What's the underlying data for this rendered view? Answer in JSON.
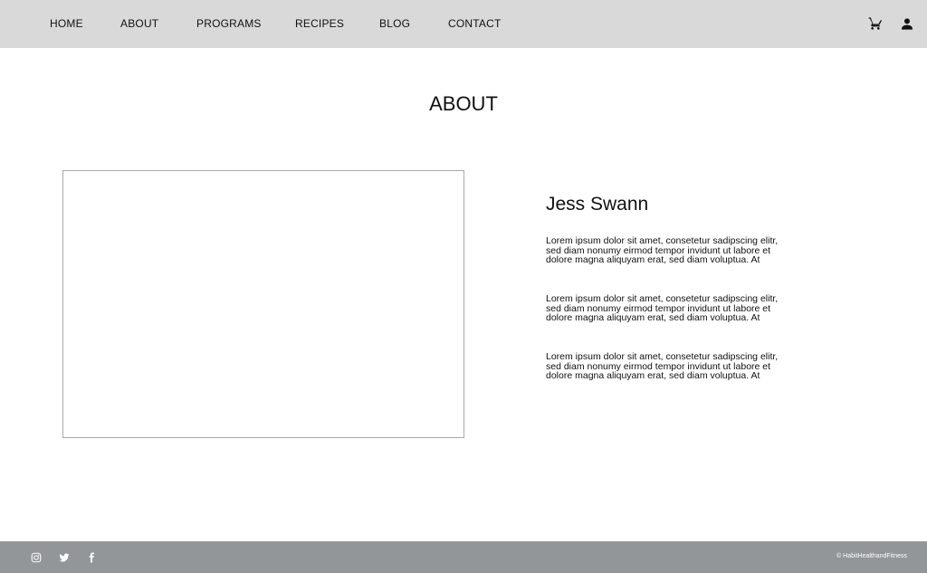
{
  "header": {
    "nav": [
      {
        "label": "HOME"
      },
      {
        "label": "ABOUT"
      },
      {
        "label": "PROGRAMS"
      },
      {
        "label": "RECIPES"
      },
      {
        "label": "BLOG"
      },
      {
        "label": "CONTACT"
      }
    ],
    "icons": {
      "cart": "shopping-cart-icon",
      "user": "user-icon"
    }
  },
  "main": {
    "title": "ABOUT",
    "profile": {
      "name": "Jess Swann",
      "paragraphs": [
        "Lorem ipsum dolor sit amet, consetetur sadipscing elitr, sed diam nonumy eirmod tempor invidunt ut labore et dolore magna aliquyam erat, sed diam voluptua. At",
        "Lorem ipsum dolor sit amet, consetetur sadipscing elitr, sed diam nonumy eirmod tempor invidunt ut labore et dolore magna aliquyam erat, sed diam voluptua. At",
        "Lorem ipsum dolor sit amet, consetetur sadipscing elitr, sed diam nonumy eirmod tempor invidunt ut labore et dolore magna aliquyam erat, sed diam voluptua. At"
      ]
    }
  },
  "footer": {
    "social": [
      "instagram-icon",
      "twitter-icon",
      "facebook-icon"
    ],
    "copyright": "© HabitHealthandFitness"
  },
  "colors": {
    "header_bg": "#d9d9d9",
    "footer_bg": "#929699",
    "placeholder_border": "#a8a8a8"
  }
}
